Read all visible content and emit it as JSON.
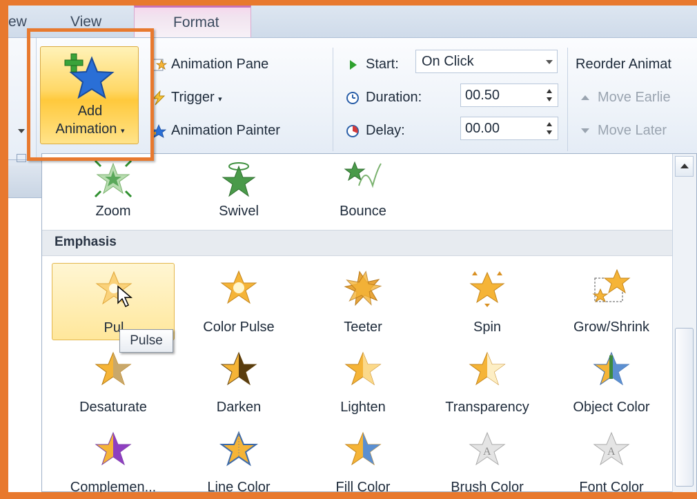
{
  "tabs": {
    "view": "View",
    "format": "Format",
    "partial_left": "ew"
  },
  "ribbon": {
    "add_animation": {
      "line1": "Add",
      "line2": "Animation"
    },
    "animation_pane": "Animation Pane",
    "trigger": "Trigger",
    "animation_painter": "Animation Painter",
    "start_label": "Start:",
    "start_value": "On Click",
    "duration_label": "Duration:",
    "duration_value": "00.50",
    "delay_label": "Delay:",
    "delay_value": "00.00",
    "reorder_label": "Reorder Animat",
    "move_earlier": "Move Earlie",
    "move_later": "Move Later"
  },
  "gallery": {
    "entrance_tail": [
      {
        "label": "Zoom",
        "icon": "zoom-star-icon",
        "color": "#4a9a4a"
      },
      {
        "label": "Swivel",
        "icon": "swivel-star-icon",
        "color": "#3d8f3d"
      },
      {
        "label": "Bounce",
        "icon": "bounce-star-icon",
        "color": "#3d8f3d"
      }
    ],
    "emphasis_header": "Emphasis",
    "emphasis_row1": [
      {
        "label": "Pulse",
        "icon": "pulse-star-icon"
      },
      {
        "label": "Color Pulse",
        "icon": "color-pulse-star-icon"
      },
      {
        "label": "Teeter",
        "icon": "teeter-star-icon"
      },
      {
        "label": "Spin",
        "icon": "spin-star-icon"
      },
      {
        "label": "Grow/Shrink",
        "icon": "grow-shrink-star-icon"
      }
    ],
    "emphasis_row2": [
      {
        "label": "Desaturate",
        "icon": "desaturate-star-icon"
      },
      {
        "label": "Darken",
        "icon": "darken-star-icon"
      },
      {
        "label": "Lighten",
        "icon": "lighten-star-icon"
      },
      {
        "label": "Transparency",
        "icon": "transparency-star-icon"
      },
      {
        "label": "Object Color",
        "icon": "object-color-star-icon"
      }
    ],
    "emphasis_row3": [
      {
        "label": "Complemen...",
        "icon": "complementary-star-icon"
      },
      {
        "label": "Line Color",
        "icon": "line-color-star-icon"
      },
      {
        "label": "Fill Color",
        "icon": "fill-color-star-icon"
      },
      {
        "label": "Brush Color",
        "icon": "brush-color-star-icon",
        "disabled": true
      },
      {
        "label": "Font Color",
        "icon": "font-color-star-icon",
        "disabled": true
      }
    ],
    "pulse_visible_label": "Pul",
    "tooltip": "Pulse"
  },
  "colors": {
    "accent_orange": "#e8792e",
    "star_gold": "#f5b437",
    "selection": "#ffe79b"
  }
}
